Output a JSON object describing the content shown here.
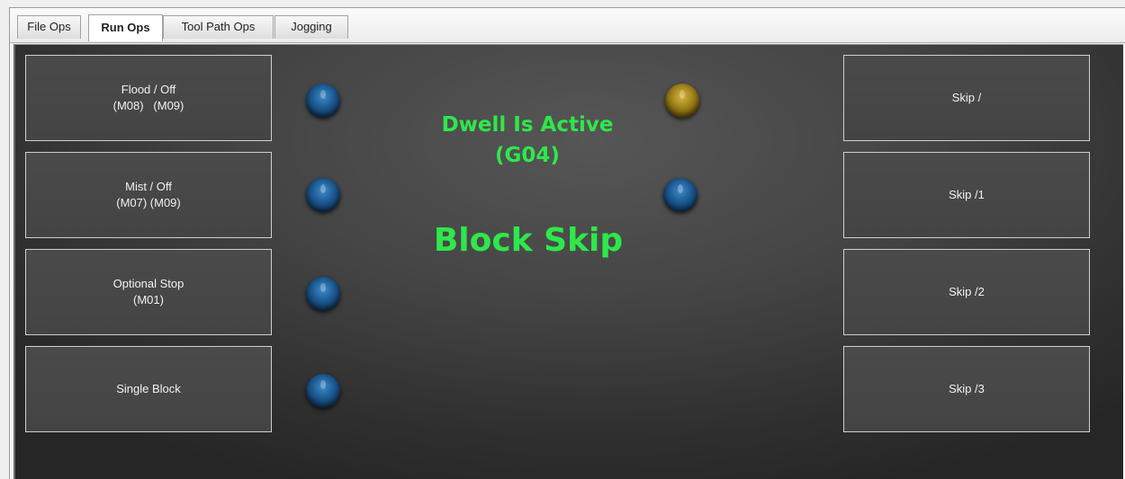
{
  "tabs": [
    {
      "label": "File Ops",
      "active": false
    },
    {
      "label": "Run Ops",
      "active": true
    },
    {
      "label": "Tool Path Ops",
      "active": false
    },
    {
      "label": "Jogging",
      "active": false
    }
  ],
  "left_buttons": [
    {
      "line1": "Flood / Off",
      "line2": "(M08)   (M09)"
    },
    {
      "line1": "Mist / Off",
      "line2": "(M07) (M09)"
    },
    {
      "line1": "Optional Stop",
      "line2": "(M01)"
    },
    {
      "line1": "Single Block",
      "line2": ""
    }
  ],
  "right_buttons": [
    {
      "label": "Skip /"
    },
    {
      "label": "Skip /1"
    },
    {
      "label": "Skip /2"
    },
    {
      "label": "Skip /3"
    }
  ],
  "status": {
    "dwell_line1": "Dwell Is Active",
    "dwell_line2": "(G04)",
    "block_skip": "Block Skip"
  },
  "leds": {
    "left": [
      "blue",
      "blue",
      "blue",
      "blue"
    ],
    "dwell": "yellow",
    "block_skip": "blue"
  },
  "colors": {
    "status_text": "#2ee84a",
    "led_blue": "#1d5b95",
    "led_yellow": "#9a7c16"
  }
}
